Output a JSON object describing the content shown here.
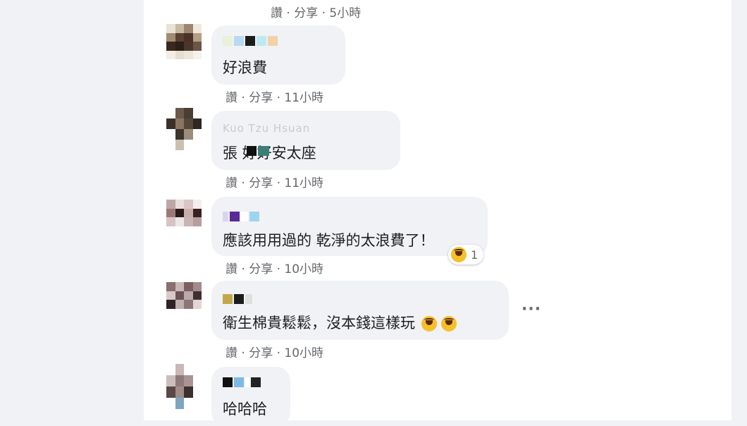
{
  "meta_top": "讚 · 分享 · 5小時",
  "comments": [
    {
      "text": "好浪費",
      "meta": "讚 · 分享 · 11小時"
    },
    {
      "author": "Kuo Tzu Hsuan",
      "text": "張 好好安太座",
      "meta": "讚 · 分享 · 11小時"
    },
    {
      "text": "應該用用過的 乾淨的太浪費了！",
      "meta": "讚 · 分享 · 10小時",
      "reaction_count": "1"
    },
    {
      "text": "衛生棉貴鬆鬆，沒本錢這樣玩",
      "meta": "讚 · 分享 · 10小時",
      "more": "···"
    },
    {
      "text": "哈哈哈"
    }
  ],
  "icons": {
    "reaction": "laughing-emoji-icon",
    "more": "more-options-icon"
  },
  "colors": {
    "page_bg": "#f0f2f5",
    "bubble_bg": "#f0f2f5",
    "meta_text": "#65676b",
    "body_text": "#1c1e21"
  }
}
